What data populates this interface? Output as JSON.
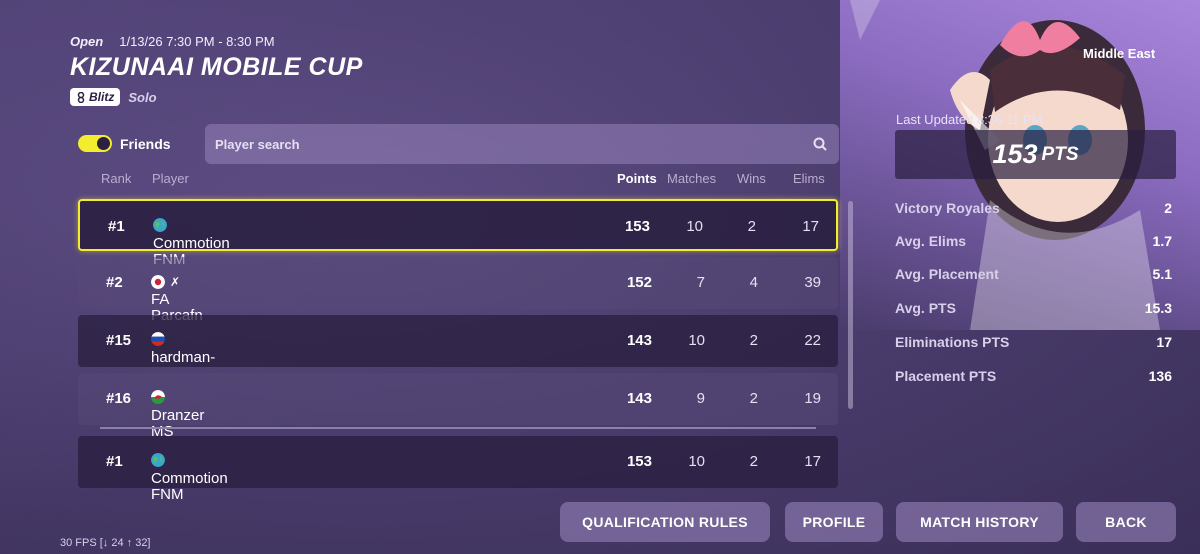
{
  "header": {
    "status": "Open",
    "datetime": "1/13/26 7:30 PM - 8:30 PM",
    "title": "KIZUNAAI MOBILE CUP",
    "mode_badge": "Blitz",
    "mode_type": "Solo"
  },
  "filters": {
    "friends_label": "Friends",
    "search_placeholder": "Player search"
  },
  "table": {
    "columns": [
      "Rank",
      "Player",
      "Points",
      "Matches",
      "Wins",
      "Elims"
    ],
    "rows": [
      {
        "rank": "#1",
        "player": "Commotion FNM",
        "flag": "globe",
        "points": "153",
        "matches": "10",
        "wins": "2",
        "elims": "17"
      },
      {
        "rank": "#2",
        "player": "FA Parcafn",
        "flag": "japan",
        "suffix": "✗",
        "points": "152",
        "matches": "7",
        "wins": "4",
        "elims": "39"
      },
      {
        "rank": "#15",
        "player": "hardman-",
        "flag": "russia",
        "points": "143",
        "matches": "10",
        "wins": "2",
        "elims": "22"
      },
      {
        "rank": "#16",
        "player": "Dranzer MS",
        "flag": "wales",
        "points": "143",
        "matches": "9",
        "wins": "2",
        "elims": "19"
      }
    ],
    "self_row": {
      "rank": "#1",
      "player": "Commotion FNM",
      "flag": "globe",
      "points": "153",
      "matches": "10",
      "wins": "2",
      "elims": "17"
    }
  },
  "summary": {
    "region": "Middle East",
    "last_updated": "Last Updated 8:36:11 PM",
    "points": "153",
    "points_unit": "PTS",
    "stats": [
      {
        "label": "Victory Royales",
        "value": "2"
      },
      {
        "label": "Avg. Elims",
        "value": "1.7"
      },
      {
        "label": "Avg. Placement",
        "value": "5.1"
      },
      {
        "label": "Avg. PTS",
        "value": "15.3"
      },
      {
        "label": "Eliminations PTS",
        "value": "17"
      },
      {
        "label": "Placement PTS",
        "value": "136"
      }
    ]
  },
  "actions": {
    "qualification_rules": "QUALIFICATION RULES",
    "profile": "PROFILE",
    "match_history": "MATCH HISTORY",
    "back": "BACK"
  },
  "fps": "30 FPS [↓ 24 ↑ 32]",
  "colors": {
    "accent_yellow": "#f4ec2e",
    "panel_dark": "#281e3e",
    "background": "#4a3c6c"
  }
}
